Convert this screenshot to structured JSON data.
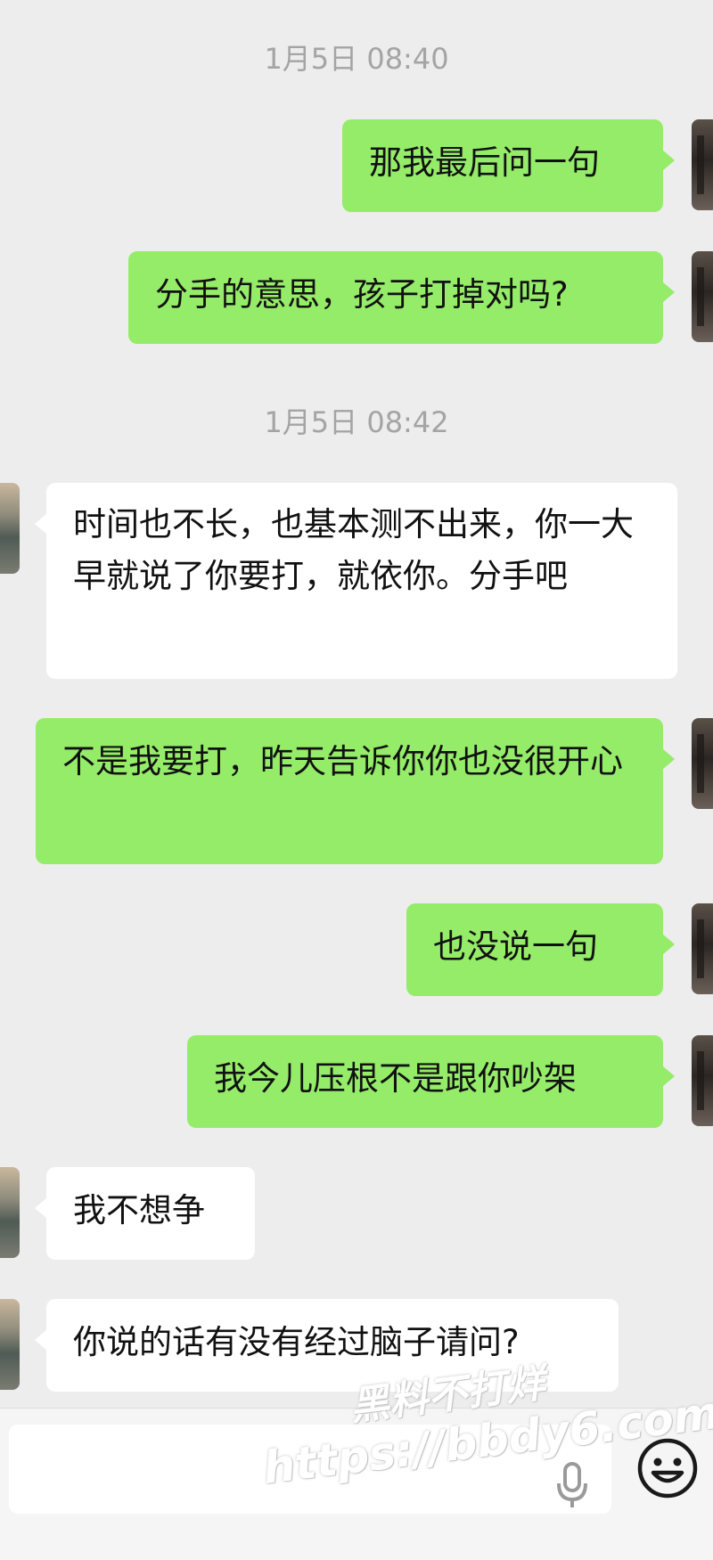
{
  "timestamps": [
    "1月5日 08:40",
    "1月5日 08:42"
  ],
  "messages": [
    {
      "text": "那我最后问一句"
    },
    {
      "text": "分手的意思，孩子打掉对吗?"
    },
    {
      "text": "时间也不长，也基本测不出来，你一大早就说了你要打，就依你。分手吧"
    },
    {
      "text": "不是我要打，昨天告诉你你也没很开心"
    },
    {
      "text": "也没说一句"
    },
    {
      "text": "我今儿压根不是跟你吵架"
    },
    {
      "text": "我不想争"
    },
    {
      "text": "你说的话有没有经过脑子请问?"
    }
  ],
  "input_bar": {
    "voice_icon": "microphone-icon",
    "emoji_icon": "smiley-face-icon"
  },
  "watermark": {
    "line1": "黑料不打烊",
    "line2": "https://bbdy6.com"
  },
  "colors": {
    "background": "#ededed",
    "outgoing_bubble": "#95ec69",
    "incoming_bubble": "#ffffff",
    "timestamp": "#a4a4a4"
  }
}
